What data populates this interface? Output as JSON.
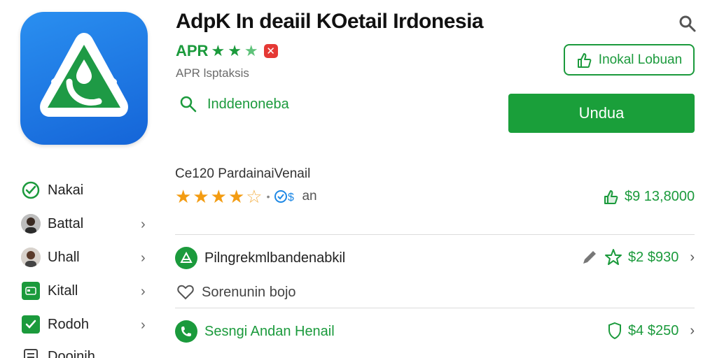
{
  "app": {
    "title": "AdpK In deaiil KOetail Irdonesia",
    "rating_label": "APR",
    "subtitle": "APR lsptaksis",
    "search_link": "Inddenoneba"
  },
  "actions": {
    "install_label": "Inokal Lobuan",
    "download_label": "Undua"
  },
  "sidebar": {
    "items": [
      {
        "label": "Nakai",
        "icon": "check-circle-icon"
      },
      {
        "label": "Battal",
        "icon": "avatar"
      },
      {
        "label": "Uhall",
        "icon": "avatar"
      },
      {
        "label": "Kitall",
        "icon": "card-icon"
      },
      {
        "label": "Rodoh",
        "icon": "checkbox-icon"
      },
      {
        "label": "Dooinih",
        "icon": "document-icon"
      }
    ]
  },
  "stats": {
    "title": "Ce120 PardainaiVenail",
    "stars": 4,
    "suffix": "an",
    "value": "$9 13,8000"
  },
  "list": [
    {
      "label": "Pilngrekmlbandenabkil",
      "price": "$2 $930",
      "color": "#222"
    },
    {
      "label": "Sorenunin bojo",
      "price": "",
      "color": "#444"
    },
    {
      "label": "Sesngi Andan Henail",
      "price": "$4 $250",
      "color": "#1b9a3c"
    }
  ],
  "colors": {
    "accent": "#1b9a3c",
    "icon_bg": "#1565d8",
    "star": "#f39c12"
  }
}
